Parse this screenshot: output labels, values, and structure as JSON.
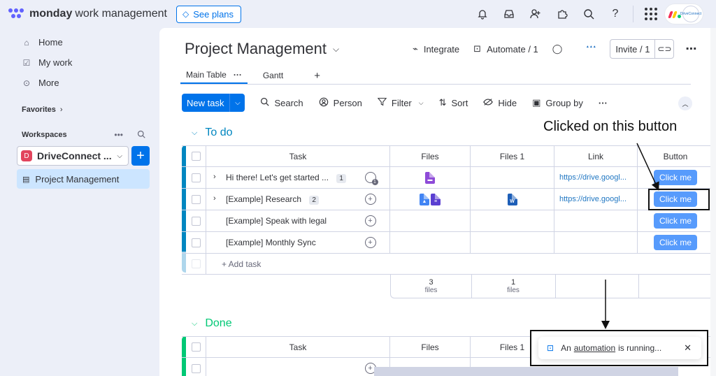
{
  "topbar": {
    "brand": "monday",
    "brand_sub": "work management",
    "see_plans": "See plans",
    "avatar_text": "DriveConnect",
    "colors": {
      "accent": "#0073ea",
      "logo_red": "#f62b54",
      "logo_yellow": "#ffcc00",
      "logo_green": "#00ca72"
    }
  },
  "sidebar": {
    "nav": [
      "Home",
      "My work",
      "More"
    ],
    "favorites_label": "Favorites",
    "workspaces_label": "Workspaces",
    "workspace_badge": "D",
    "workspace_name": "DriveConnect ...",
    "board_link": "Project Management"
  },
  "board": {
    "title": "Project Management",
    "integrate": "Integrate",
    "automate": "Automate / 1",
    "invite": "Invite / 1",
    "tabs": [
      "Main Table",
      "Gantt"
    ],
    "toolbar": {
      "new_task": "New task",
      "search": "Search",
      "person": "Person",
      "filter": "Filter",
      "sort": "Sort",
      "hide": "Hide",
      "group_by": "Group by"
    }
  },
  "groups": {
    "todo": {
      "title": "To do",
      "color": "#0086c0",
      "columns": [
        "Task",
        "Files",
        "Files 1",
        "Link",
        "Button"
      ],
      "rows": [
        {
          "task": "Hi there! Let's get started ...",
          "subitems": "1",
          "link": "https://drive.googl...",
          "button": "Click me"
        },
        {
          "task": "[Example] Research",
          "subitems": "2",
          "link": "https://drive.googl...",
          "button": "Click me"
        },
        {
          "task": "[Example] Speak with legal",
          "button": "Click me"
        },
        {
          "task": "[Example] Monthly Sync",
          "button": "Click me"
        }
      ],
      "add_task": "+ Add task",
      "summary": {
        "files_count": "3",
        "files_1_count": "1",
        "unit": "files"
      }
    },
    "done": {
      "title": "Done",
      "color": "#00c875",
      "columns": [
        "Task",
        "Files",
        "Files 1"
      ]
    }
  },
  "annotation": {
    "text": "Clicked on this button"
  },
  "toast": {
    "prefix": "An",
    "link": "automation",
    "suffix": "is running..."
  }
}
